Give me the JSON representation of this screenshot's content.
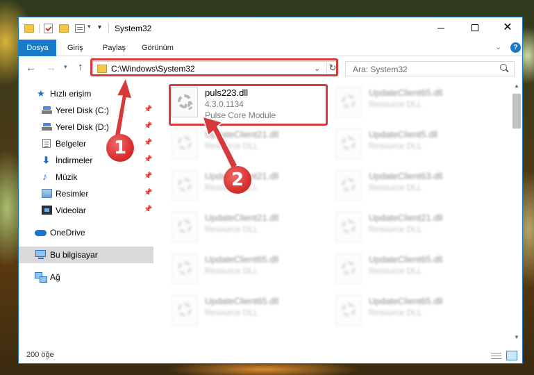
{
  "window": {
    "title": "System32",
    "controls": {
      "minimize_icon": "minimize-icon",
      "maximize_icon": "maximize-icon",
      "close_icon": "close-icon"
    }
  },
  "ribbon": {
    "tabs": [
      "Dosya",
      "Giriş",
      "Paylaş",
      "Görünüm"
    ],
    "help_label": "?"
  },
  "address": {
    "path": "C:\\Windows\\System32",
    "search_placeholder": "Ara: System32"
  },
  "sidebar": {
    "items": [
      {
        "label": "Hızlı erişim",
        "icon": "star-icon"
      },
      {
        "label": "Yerel Disk (C:)",
        "icon": "disk-icon",
        "pinned": true
      },
      {
        "label": "Yerel Disk (D:)",
        "icon": "disk-icon",
        "pinned": true
      },
      {
        "label": "Belgeler",
        "icon": "documents-icon",
        "pinned": true
      },
      {
        "label": "İndirmeler",
        "icon": "download-icon",
        "pinned": true
      },
      {
        "label": "Müzik",
        "icon": "music-icon",
        "pinned": true
      },
      {
        "label": "Resimler",
        "icon": "pictures-icon",
        "pinned": true
      },
      {
        "label": "Videolar",
        "icon": "videos-icon",
        "pinned": true
      },
      {
        "label": "OneDrive",
        "icon": "cloud-icon"
      },
      {
        "label": "Bu bilgisayar",
        "icon": "computer-icon",
        "selected": true
      },
      {
        "label": "Ağ",
        "icon": "network-icon"
      }
    ]
  },
  "files": {
    "highlighted": {
      "name": "puls223.dll",
      "version": "4.3.0.1134",
      "description": "Pulse Core Module"
    },
    "left_column": [
      {
        "name": "UpdateClient21.dll",
        "type": "Resource DLL"
      },
      {
        "name": "UpdateClient21.dll",
        "type": "Resource DLL"
      },
      {
        "name": "UpdateClient21.dll",
        "type": "Resource DLL"
      },
      {
        "name": "UpdateClient65.dll",
        "type": "Resource DLL"
      },
      {
        "name": "UpdateClient65.dll",
        "type": "Resource DLL"
      }
    ],
    "right_column": [
      {
        "name": "UpdateClient65.dll",
        "type": "Resource DLL"
      },
      {
        "name": "UpdateClient5.dll",
        "type": "Resource DLL"
      },
      {
        "name": "UpdateClient63.dll",
        "type": "Resource DLL"
      },
      {
        "name": "UpdateClient21.dll",
        "type": "Resource DLL"
      },
      {
        "name": "UpdateClient65.dll",
        "type": "Resource DLL"
      },
      {
        "name": "UpdateClient65.dll",
        "type": "Resource DLL"
      }
    ]
  },
  "annotations": {
    "marker1": "1",
    "marker2": "2",
    "color": "#d63a3a"
  },
  "status": {
    "item_count": "200 öğe"
  }
}
